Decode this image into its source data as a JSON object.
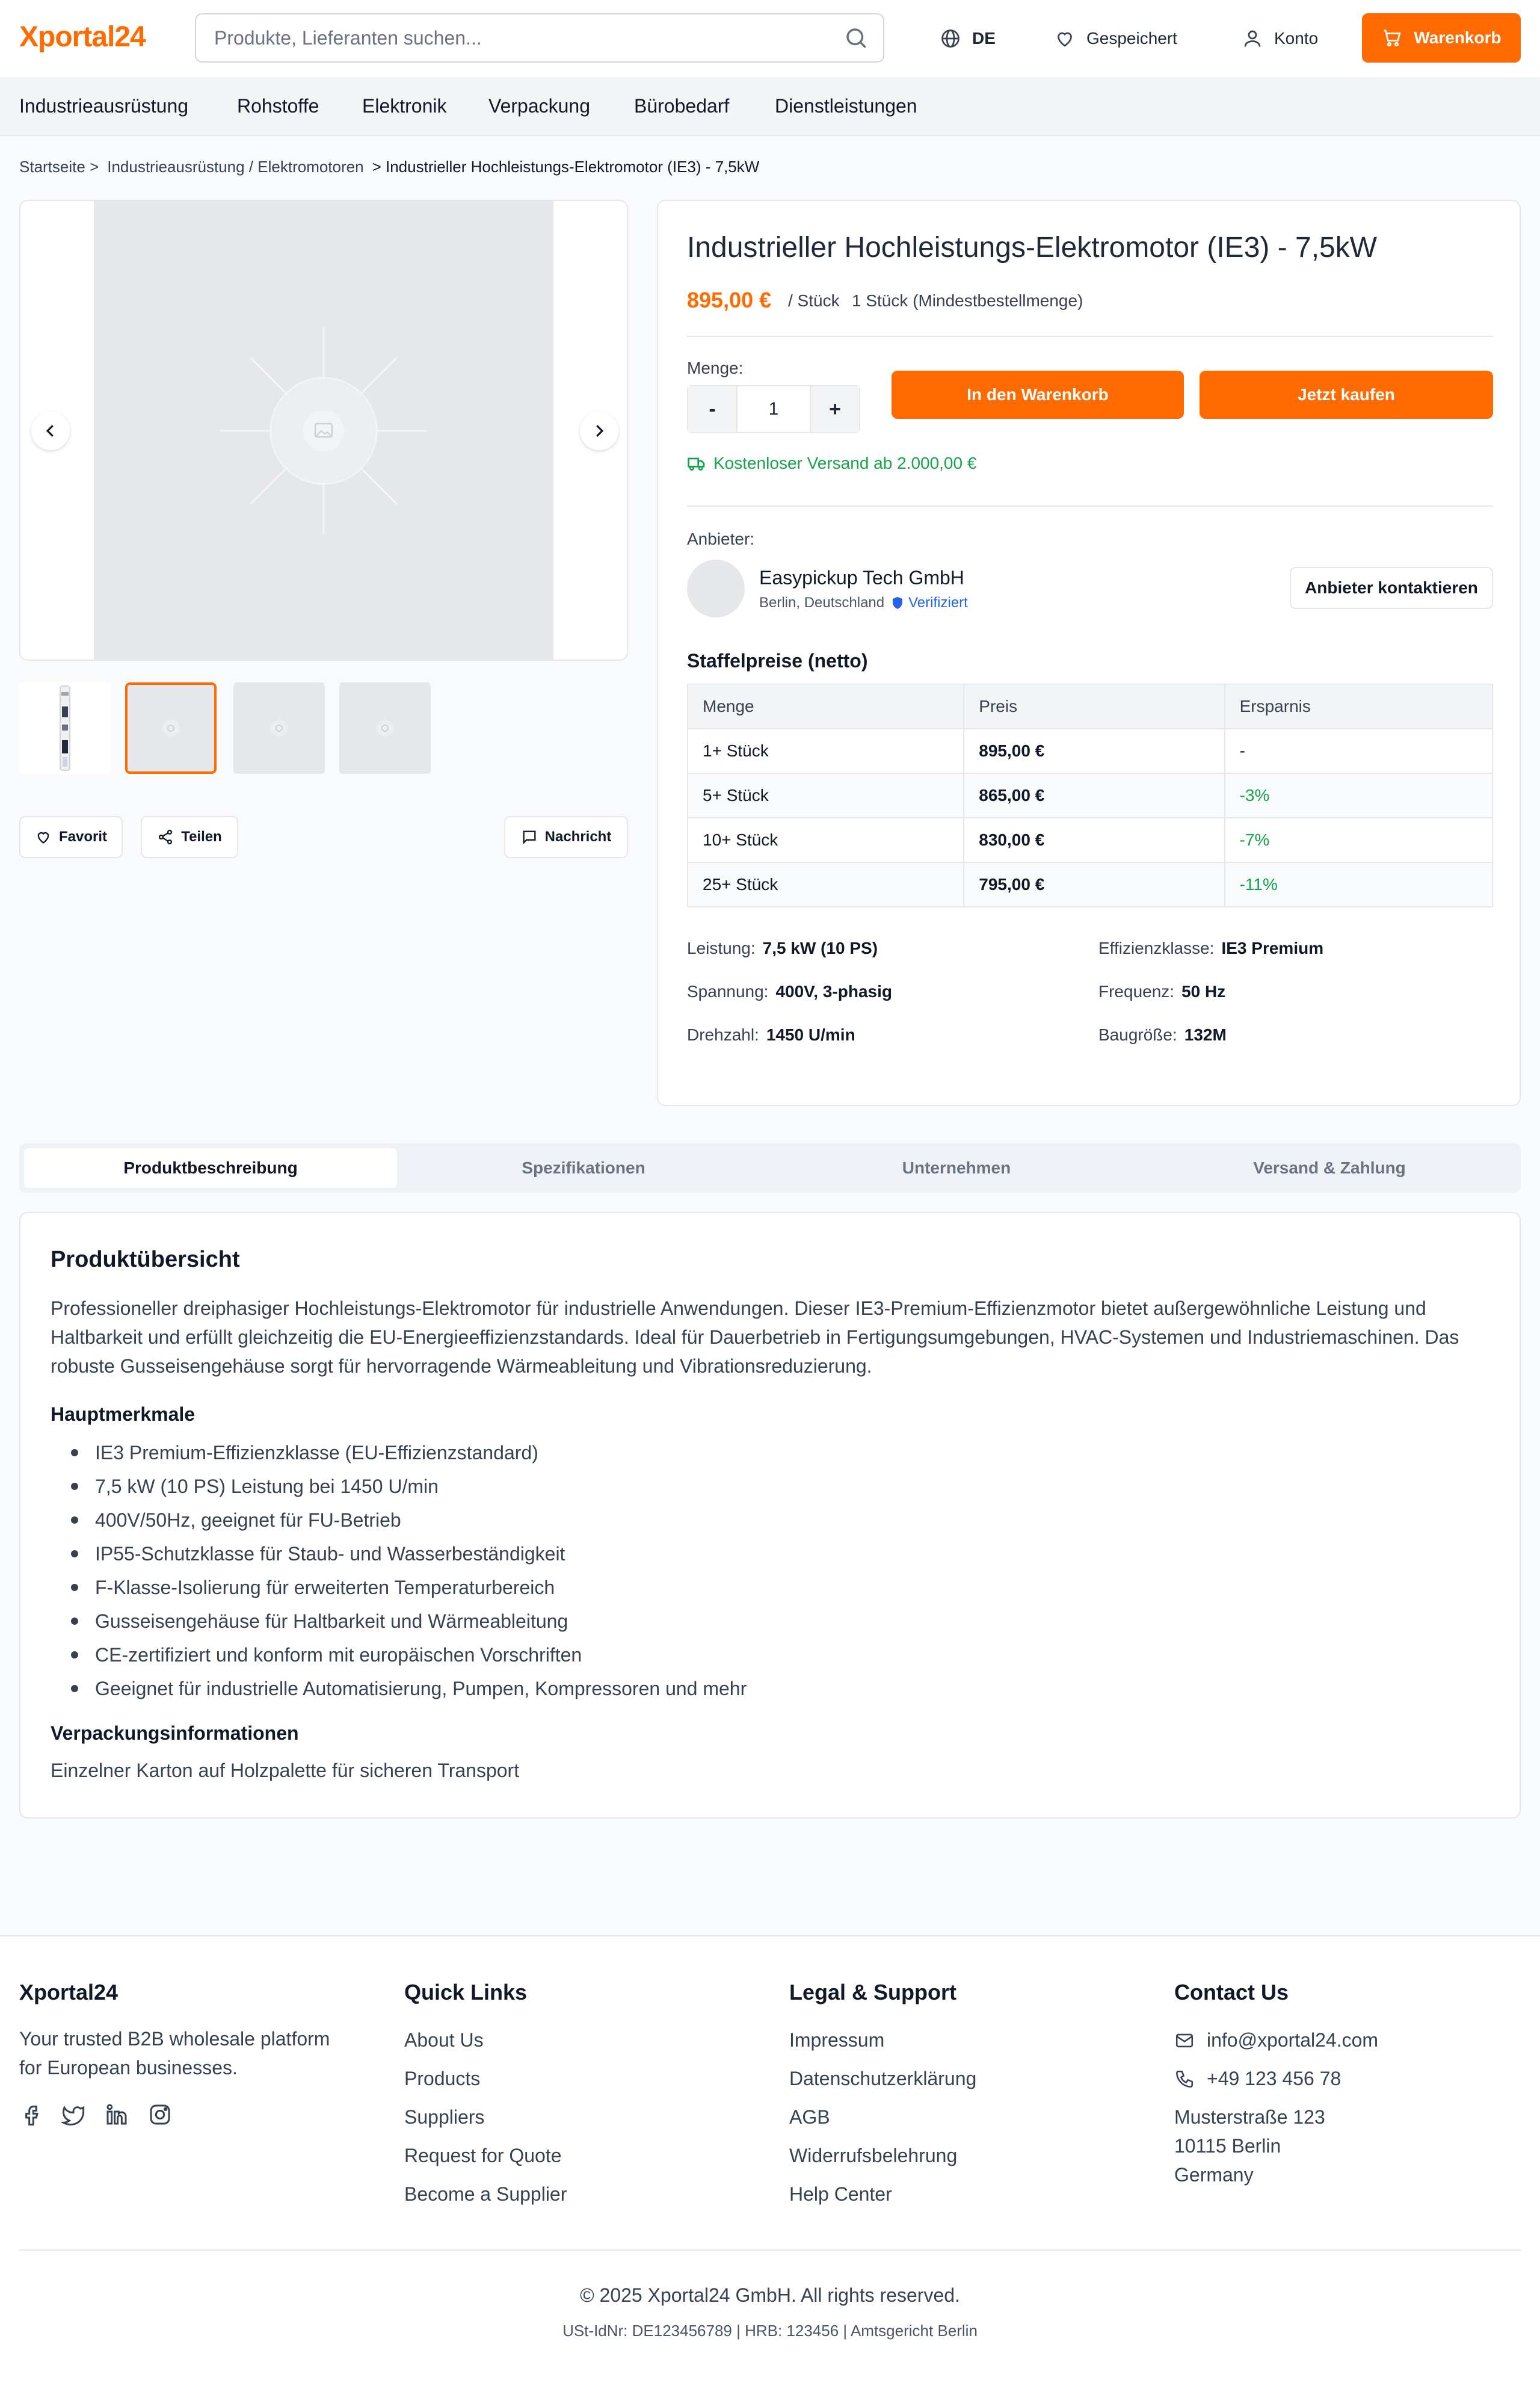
{
  "header": {
    "logo": "Xportal24",
    "search_placeholder": "Produkte, Lieferanten suchen...",
    "language": "DE",
    "saved": "Gespeichert",
    "account": "Konto",
    "cart": "Warenkorb",
    "accent": "#ff6b00"
  },
  "nav": [
    "Industrieausrüstung",
    "Rohstoffe",
    "Elektronik",
    "Verpackung",
    "Bürobedarf",
    "Dienstleistungen"
  ],
  "breadcrumb": {
    "home": "Startseite >",
    "category": "Industrieausrüstung / Elektromotoren",
    "current": "> Industrieller Hochleistungs-Elektromotor (IE3) - 7,5kW"
  },
  "gallery": {
    "actions": {
      "favorite": "Favorit",
      "share": "Teilen",
      "message": "Nachricht"
    }
  },
  "product": {
    "title": "Industrieller Hochleistungs-Elektromotor (IE3) - 7,5kW",
    "price": "895,00 €",
    "price_unit": "/ Stück",
    "moq": "1 Stück (Mindestbestellmenge)",
    "quantity_label": "Menge:",
    "quantity": "1",
    "minus": "-",
    "plus": "+",
    "add_to_cart": "In den Warenkorb",
    "buy_now": "Jetzt kaufen",
    "shipping": "Kostenloser Versand ab 2.000,00 €"
  },
  "supplier": {
    "label": "Anbieter:",
    "name": "Easypickup Tech GmbH",
    "location": "Berlin, Deutschland",
    "verified": "Verifiziert",
    "contact": "Anbieter kontaktieren"
  },
  "tiers": {
    "title": "Staffelpreise (netto)",
    "headers": [
      "Menge",
      "Preis",
      "Ersparnis"
    ],
    "rows": [
      [
        "1+ Stück",
        "895,00 €",
        "-"
      ],
      [
        "5+ Stück",
        "865,00 €",
        "-3%"
      ],
      [
        "10+ Stück",
        "830,00 €",
        "-7%"
      ],
      [
        "25+ Stück",
        "795,00 €",
        "-11%"
      ]
    ]
  },
  "specs": [
    {
      "label": "Leistung:",
      "value": "7,5 kW (10 PS)"
    },
    {
      "label": "Effizienzklasse:",
      "value": "IE3 Premium"
    },
    {
      "label": "Spannung:",
      "value": "400V, 3-phasig"
    },
    {
      "label": "Frequenz:",
      "value": "50 Hz"
    },
    {
      "label": "Drehzahl:",
      "value": "1450 U/min"
    },
    {
      "label": "Baugröße:",
      "value": "132M"
    }
  ],
  "tabs": [
    "Produktbeschreibung",
    "Spezifikationen",
    "Unternehmen",
    "Versand & Zahlung"
  ],
  "description": {
    "title": "Produktübersicht",
    "text": "Professioneller dreiphasiger Hochleistungs-Elektromotor für industrielle Anwendungen. Dieser IE3-Premium-Effizienzmotor bietet außergewöhnliche Leistung und Haltbarkeit und erfüllt gleichzeitig die EU-Energieeffizienzstandards. Ideal für Dauerbetrieb in Fertigungsumgebungen, HVAC-Systemen und Industriemaschinen. Das robuste Gusseisengehäuse sorgt für hervorragende Wärmeableitung und Vibrationsreduzierung.",
    "features_title": "Hauptmerkmale",
    "features": [
      "IE3 Premium-Effizienzklasse (EU-Effizienzstandard)",
      "7,5 kW (10 PS) Leistung bei 1450 U/min",
      "400V/50Hz, geeignet für FU-Betrieb",
      "IP55-Schutzklasse für Staub- und Wasserbeständigkeit",
      "F-Klasse-Isolierung für erweiterten Temperaturbereich",
      "Gusseisengehäuse für Haltbarkeit und Wärmeableitung",
      "CE-zertifiziert und konform mit europäischen Vorschriften",
      "Geeignet für industrielle Automatisierung, Pumpen, Kompressoren und mehr"
    ],
    "packaging_title": "Verpackungsinformationen",
    "packaging_text": "Einzelner Karton auf Holzpalette für sicheren Transport"
  },
  "footer": {
    "brand": "Xportal24",
    "tagline_1": "Your trusted B2B wholesale platform",
    "tagline_2": "for European businesses.",
    "quick_title": "Quick Links",
    "quick_links": [
      "About Us",
      "Products",
      "Suppliers",
      "Request for Quote",
      "Become a Supplier"
    ],
    "legal_title": "Legal & Support",
    "legal_links": [
      "Impressum",
      "Datenschutzerklärung",
      "AGB",
      "Widerrufsbelehrung",
      "Help Center"
    ],
    "contact_title": "Contact Us",
    "email": "info@xportal24.com",
    "phone": "+49 123 456 78",
    "address_1": "Musterstraße 123",
    "address_2": "10115 Berlin",
    "address_3": "Germany",
    "copyright": "© 2025 Xportal24 GmbH. All rights reserved.",
    "legal_line": "USt-IdNr: DE123456789 | HRB: 123456 | Amtsgericht Berlin"
  }
}
